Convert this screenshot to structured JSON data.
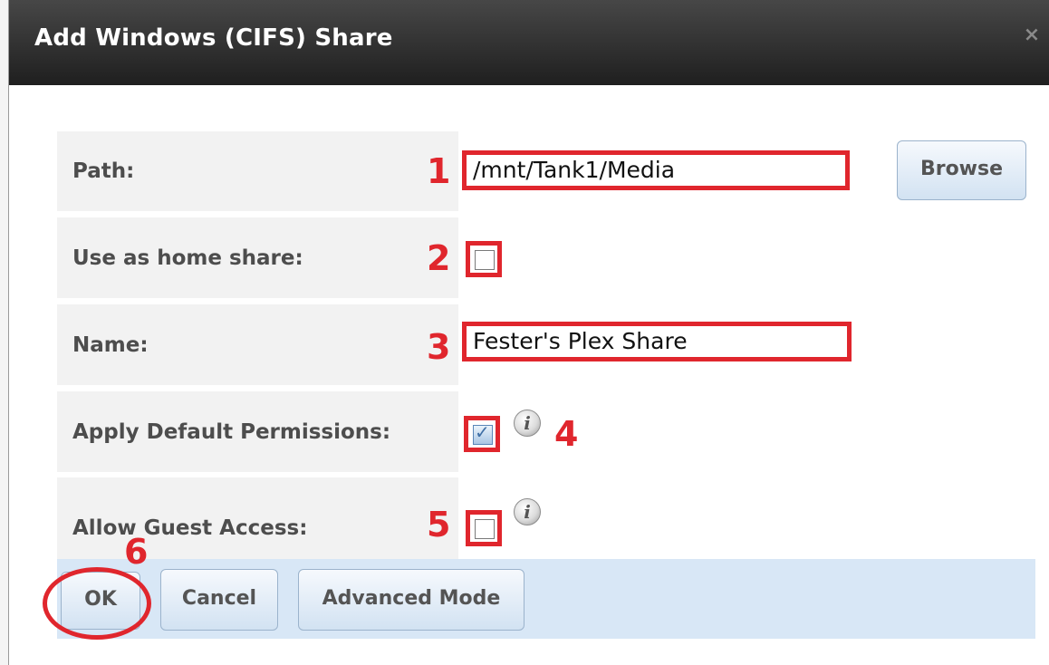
{
  "dialog": {
    "title": "Add Windows (CIFS) Share",
    "close_icon": "close-x-icon"
  },
  "form": {
    "path_label": "Path:",
    "path_value": "/mnt/Tank1/Media",
    "browse_label": "Browse",
    "home_share_label": "Use as home share:",
    "home_share_checked": false,
    "name_label": "Name:",
    "name_value": "Fester's Plex Share",
    "default_permissions_label": "Apply Default Permissions:",
    "default_permissions_checked": true,
    "guest_access_label": "Allow Guest Access:",
    "guest_access_checked": false,
    "info_icon": "i"
  },
  "buttons": {
    "ok": "OK",
    "cancel": "Cancel",
    "advanced": "Advanced Mode"
  },
  "annotations": {
    "n1": "1",
    "n2": "2",
    "n3": "3",
    "n4": "4",
    "n5": "5",
    "n6": "6",
    "color": "#e0262d"
  }
}
